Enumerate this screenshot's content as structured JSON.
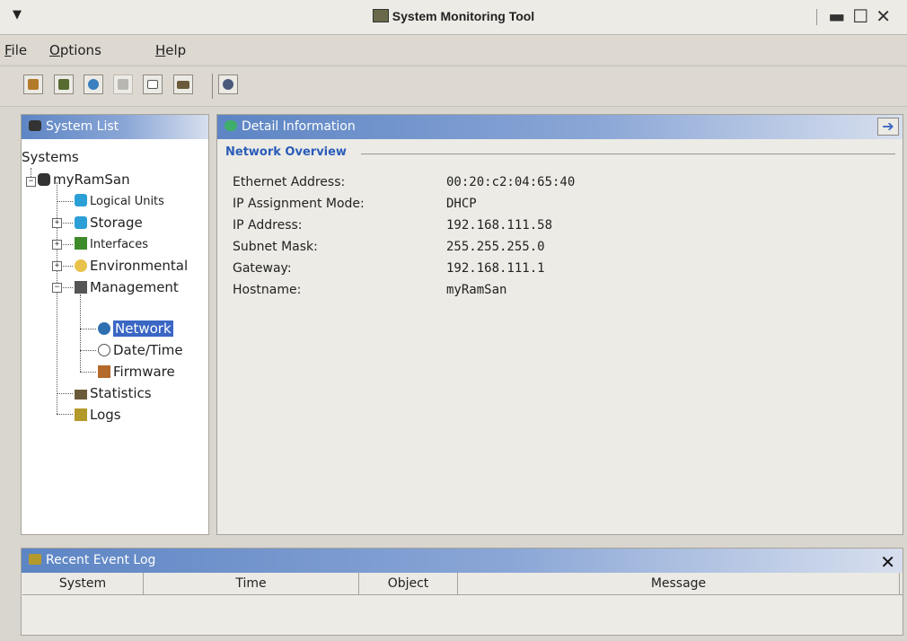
{
  "window": {
    "title": "System Monitoring Tool"
  },
  "menu": {
    "file": {
      "label": "File",
      "accel": "F",
      "rest": "ile"
    },
    "options": {
      "label": "Options",
      "accel": "O",
      "rest": "ptions"
    },
    "help": {
      "label": "Help",
      "accel": "H",
      "rest": "elp"
    }
  },
  "toolbar": {
    "buttons": [
      {
        "icon": "logs-icon",
        "color": "#b37a2a"
      },
      {
        "icon": "system-add-icon",
        "color": "#556b2f"
      },
      {
        "icon": "network-globe-icon",
        "color": "#3a7fbf"
      },
      {
        "icon": "disabled-grid-icon",
        "color": "#b8b6b0"
      },
      {
        "icon": "collapse-tree-icon",
        "color": "#777777"
      },
      {
        "icon": "statistics-icon",
        "color": "#6b5a3a"
      }
    ],
    "extra": {
      "icon": "refresh-monitor-icon",
      "color": "#4a5a7a"
    }
  },
  "system_list": {
    "title": "System List",
    "root": "Systems",
    "system": "myRamSan",
    "items": {
      "logical_units": "Logical Units",
      "storage": "Storage",
      "interfaces": "Interfaces",
      "environmental": "Environmental",
      "management": "Management",
      "network": "Network",
      "datetime": "Date/Time",
      "firmware": "Firmware",
      "statistics": "Statistics",
      "logs": "Logs"
    }
  },
  "detail": {
    "title": "Detail Information",
    "group": "Network Overview",
    "rows": [
      {
        "label": "Ethernet Address:",
        "value": "00:20:c2:04:65:40"
      },
      {
        "label": "IP Assignment Mode:",
        "value": "DHCP"
      },
      {
        "label": "IP Address:",
        "value": "192.168.111.58"
      },
      {
        "label": "Subnet Mask:",
        "value": "255.255.255.0"
      },
      {
        "label": "Gateway:",
        "value": "192.168.111.1"
      },
      {
        "label": "Hostname:",
        "value": "myRamSan"
      }
    ]
  },
  "event_log": {
    "title": "Recent Event Log",
    "columns": [
      "System",
      "Time",
      "Object",
      "Message"
    ]
  },
  "colors": {
    "accent": "#3a66c4",
    "header_start": "#5d85c4",
    "group_title": "#2a5cb8"
  }
}
